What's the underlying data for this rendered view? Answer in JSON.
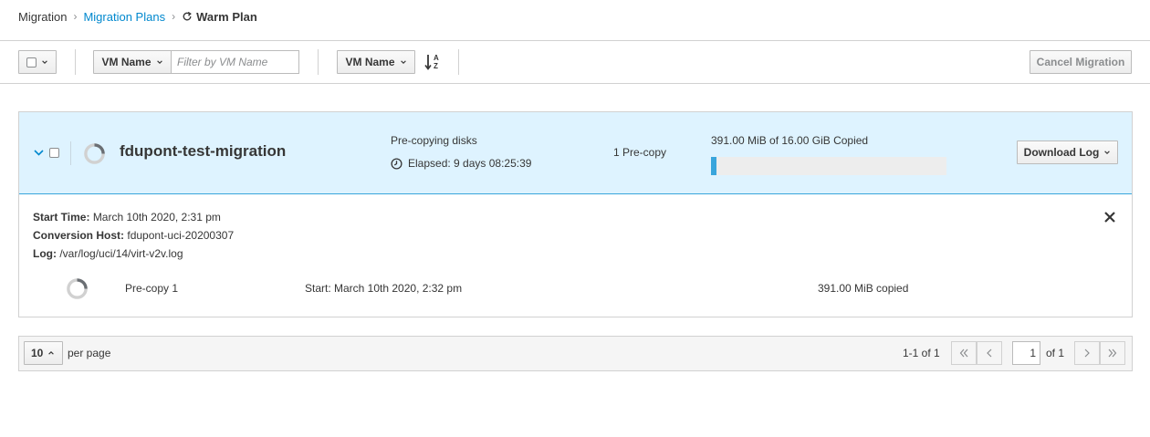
{
  "breadcrumb": {
    "root": "Migration",
    "plans": "Migration Plans",
    "current": "Warm Plan"
  },
  "toolbar": {
    "filter_field": "VM Name",
    "filter_placeholder": "Filter by VM Name",
    "sort_field": "VM Name",
    "cancel_label": "Cancel Migration"
  },
  "vm": {
    "name": "fdupont-test-migration",
    "status": "Pre-copying disks",
    "elapsed": "Elapsed: 9 days 08:25:39",
    "precopy_count": "1 Pre-copy",
    "copied": "391.00 MiB of 16.00 GiB Copied",
    "progress_fraction": 0.0239,
    "download_label": "Download Log"
  },
  "details": {
    "start_time_label": "Start Time:",
    "start_time_value": "March 10th 2020, 2:31 pm",
    "host_label": "Conversion Host:",
    "host_value": "fdupont-uci-20200307",
    "log_label": "Log:",
    "log_value": "/var/log/uci/14/virt-v2v.log",
    "step": {
      "label": "Pre-copy 1",
      "start": "Start: March 10th 2020, 2:32 pm",
      "copied": "391.00 MiB copied"
    }
  },
  "pagination": {
    "per_page": "10",
    "per_page_label": "per page",
    "range": "1-1 of 1",
    "current_page": "1",
    "of_total": "of 1"
  },
  "colors": {
    "link": "#0088ce",
    "header_bg": "#def3ff",
    "progress": "#39a5dc"
  }
}
